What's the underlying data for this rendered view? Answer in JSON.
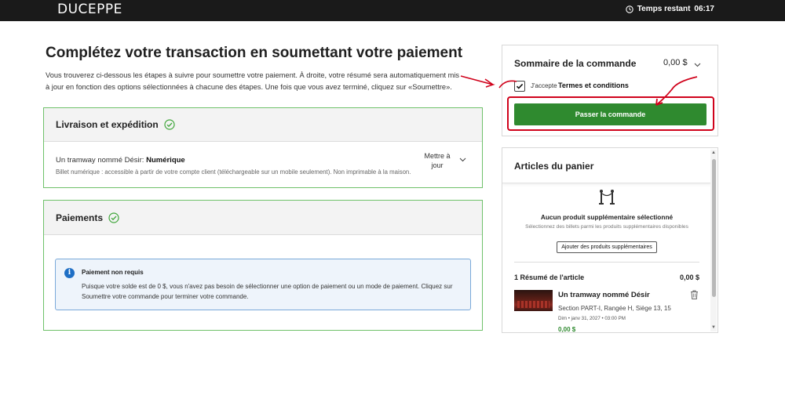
{
  "header": {
    "logo": "DUCEPPE",
    "timer_label": "Temps restant",
    "timer_value": "06:17"
  },
  "main": {
    "title": "Complétez votre transaction en soumettant votre paiement",
    "intro": "Vous trouverez ci-dessous les étapes à suivre pour soumettre votre paiement. À droite, votre résumé sera automatiquement mis à jour en fonction des options sélectionnées à chacune des étapes. Une fois que vous avez terminé, cliquez sur «Soumettre»."
  },
  "delivery": {
    "title": "Livraison et expédition",
    "item_prefix": "Un tramway nommé Désir: ",
    "item_type": "Numérique",
    "note": "Billet numérique : accessible à partir de votre compte client (téléchargeable sur un mobile seulement). Non imprimable à la maison.",
    "date_label": "Mettre à jour"
  },
  "payments": {
    "title": "Paiements",
    "info_title": "Paiement non requis",
    "info_text": "Puisque votre solde est de 0 $, vous n'avez pas besoin de sélectionner une option de paiement ou un mode de paiement. Cliquez sur Soumettre votre commande pour terminer votre commande."
  },
  "summary": {
    "title": "Sommaire de la commande",
    "amount": "0,00 $",
    "terms_prefix": "J'accepte",
    "terms_link": "Termes et conditions",
    "terms_checked": true,
    "order_button": "Passer la commande"
  },
  "cart": {
    "title": "Articles du panier",
    "empty_title": "Aucun produit supplémentaire sélectionné",
    "empty_sub": "Sélectionnez des billets parmi les produits supplémentaires disponibles",
    "add_button": "Ajouter des produits supplémentaires",
    "resume_title": "1 Résumé de l'article",
    "resume_amount": "0,00 $",
    "item": {
      "name": "Un tramway nommé Désir",
      "seat": "Section PART-I, Rangée H, Siège 13, 15",
      "date": "Dim • janv 31, 2027 • 03:00 PM",
      "price": "0,00 $"
    }
  },
  "colors": {
    "topbar": "#1a1a1a",
    "accent_green": "#2f8a2f",
    "card_border": "#6fc16a",
    "info_blue": "#1f6fc5",
    "annotation_red": "#d0021b"
  }
}
